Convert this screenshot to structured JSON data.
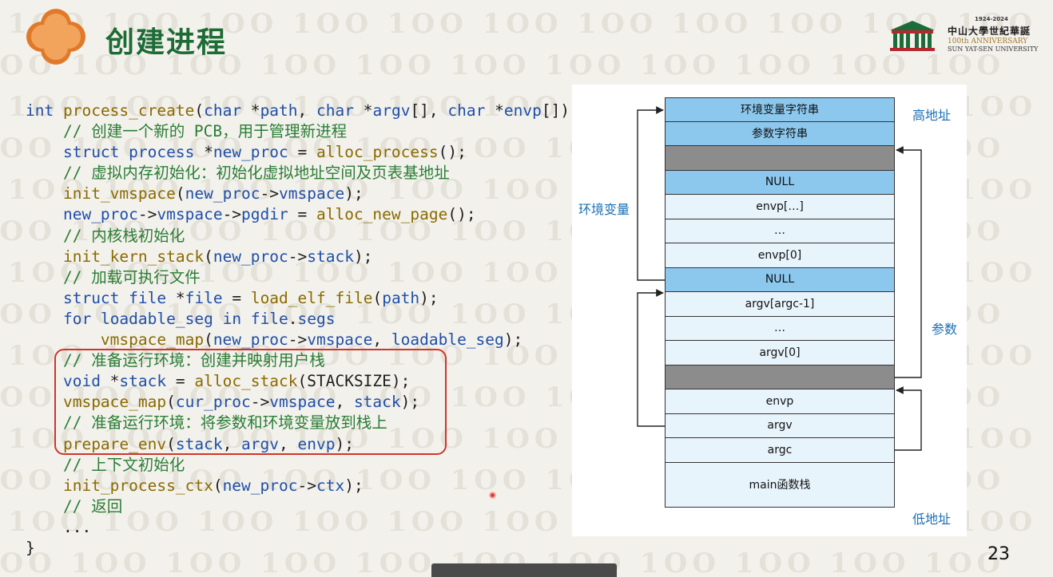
{
  "slide": {
    "title": "创建进程",
    "page_number": "23",
    "logo": {
      "years": "1924-2024",
      "name_cn": "中山大學世紀華誕",
      "anniversary": "100th ANNIVERSARY",
      "university": "SUN YAT-SEN UNIVERSITY"
    }
  },
  "code": {
    "lines": [
      "int process_create(char *path, char *argv[], char *envp[]) {",
      "    // 创建一个新的 PCB，用于管理新进程",
      "    struct process *new_proc = alloc_process();",
      "    // 虚拟内存初始化：初始化虚拟地址空间及页表基地址",
      "    init_vmspace(new_proc->vmspace);",
      "    new_proc->vmspace->pgdir = alloc_new_page();",
      "    // 内核栈初始化",
      "    init_kern_stack(new_proc->stack);",
      "    // 加载可执行文件",
      "    struct file *file = load_elf_file(path);",
      "    for loadable_seg in file.segs",
      "        vmspace_map(new_proc->vmspace, loadable_seg);",
      "    // 准备运行环境：创建并映射用户栈",
      "    void *stack = alloc_stack(STACKSIZE);",
      "    vmspace_map(cur_proc->vmspace, stack);",
      "    // 准备运行环境：将参数和环境变量放到栈上",
      "    prepare_env(stack, argv, envp);",
      "    // 上下文初始化",
      "    init_process_ctx(new_proc->ctx);",
      "    // 返回",
      "    ...",
      "}"
    ]
  },
  "diagram": {
    "cells": [
      {
        "label": "环境变量字符串",
        "style": "blue"
      },
      {
        "label": "参数字符串",
        "style": "blue"
      },
      {
        "label": "",
        "style": "gray"
      },
      {
        "label": "NULL",
        "style": "blue"
      },
      {
        "label": "envp[…]",
        "style": "light"
      },
      {
        "label": "…",
        "style": "light"
      },
      {
        "label": "envp[0]",
        "style": "light"
      },
      {
        "label": "NULL",
        "style": "blue"
      },
      {
        "label": "argv[argc-1]",
        "style": "light"
      },
      {
        "label": "…",
        "style": "light"
      },
      {
        "label": "argv[0]",
        "style": "light"
      },
      {
        "label": "",
        "style": "gray"
      },
      {
        "label": "envp",
        "style": "light"
      },
      {
        "label": "argv",
        "style": "light"
      },
      {
        "label": "argc",
        "style": "light"
      },
      {
        "label": "main函数栈",
        "style": "light"
      }
    ],
    "labels": {
      "high_addr": "高地址",
      "low_addr": "低地址",
      "env_vars": "环境变量",
      "args": "参数"
    }
  }
}
